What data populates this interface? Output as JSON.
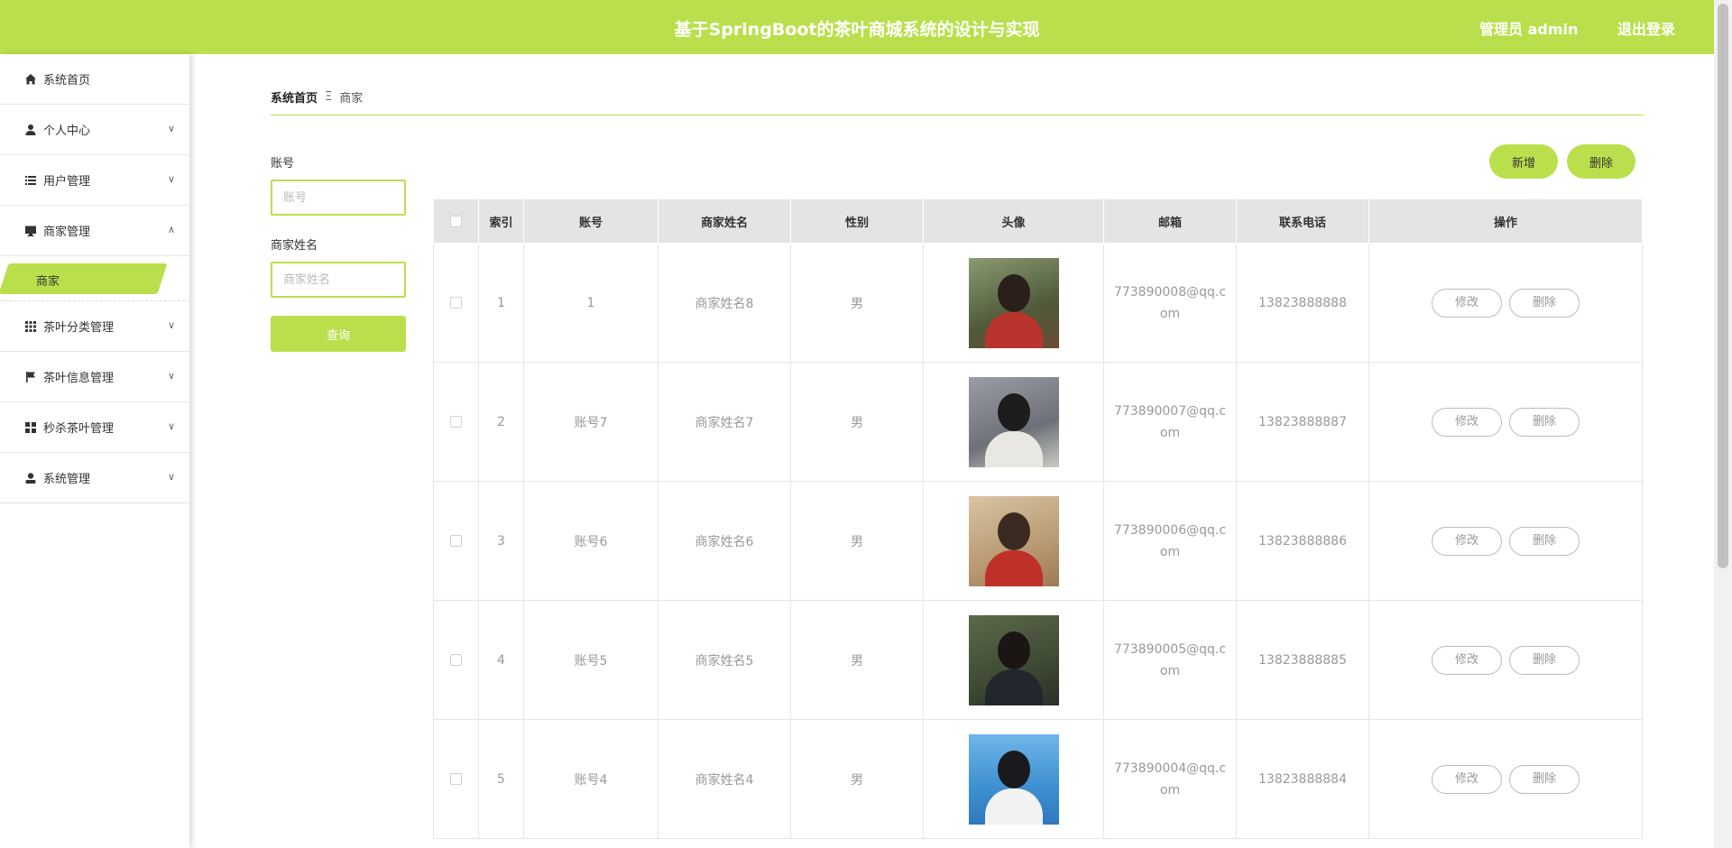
{
  "header": {
    "title": "基于SpringBoot的茶叶商城系统的设计与实现",
    "user": "管理员 admin",
    "logout": "退出登录",
    "accent": "#b9e04c"
  },
  "sidebar": {
    "items": [
      {
        "label": "系统首页",
        "icon": "home-icon"
      },
      {
        "label": "个人中心",
        "icon": "person-icon"
      },
      {
        "label": "用户管理",
        "icon": "list-icon"
      },
      {
        "label": "商家管理",
        "icon": "monitor-icon"
      },
      {
        "label": "茶叶分类管理",
        "icon": "grid-icon"
      },
      {
        "label": "茶叶信息管理",
        "icon": "flag-icon"
      },
      {
        "label": "秒杀茶叶管理",
        "icon": "apps-icon"
      },
      {
        "label": "系统管理",
        "icon": "user-icon"
      }
    ],
    "active_sub": "商家"
  },
  "breadcrumb": {
    "home": "系统首页",
    "separator": "Ξ",
    "current": "商家"
  },
  "search": {
    "account_label": "账号",
    "account_placeholder": "账号",
    "name_label": "商家姓名",
    "name_placeholder": "商家姓名",
    "query_button": "查询"
  },
  "actions": {
    "add": "新增",
    "delete": "删除"
  },
  "table": {
    "headers": [
      "",
      "索引",
      "账号",
      "商家姓名",
      "性别",
      "头像",
      "邮箱",
      "联系电话",
      "操作"
    ],
    "rows": [
      {
        "index": "1",
        "account": "1",
        "name": "商家姓名8",
        "gender": "男",
        "email": "773890008@qq.com",
        "phone": "13823888888",
        "edit": "修改",
        "delete": "删除"
      },
      {
        "index": "2",
        "account": "账号7",
        "name": "商家姓名7",
        "gender": "男",
        "email": "773890007@qq.com",
        "phone": "13823888887",
        "edit": "修改",
        "delete": "删除"
      },
      {
        "index": "3",
        "account": "账号6",
        "name": "商家姓名6",
        "gender": "男",
        "email": "773890006@qq.com",
        "phone": "13823888886",
        "edit": "修改",
        "delete": "删除"
      },
      {
        "index": "4",
        "account": "账号5",
        "name": "商家姓名5",
        "gender": "男",
        "email": "773890005@qq.com",
        "phone": "13823888885",
        "edit": "修改",
        "delete": "删除"
      },
      {
        "index": "5",
        "account": "账号4",
        "name": "商家姓名4",
        "gender": "男",
        "email": "773890004@qq.com",
        "phone": "13823888884",
        "edit": "修改",
        "delete": "删除"
      }
    ]
  }
}
